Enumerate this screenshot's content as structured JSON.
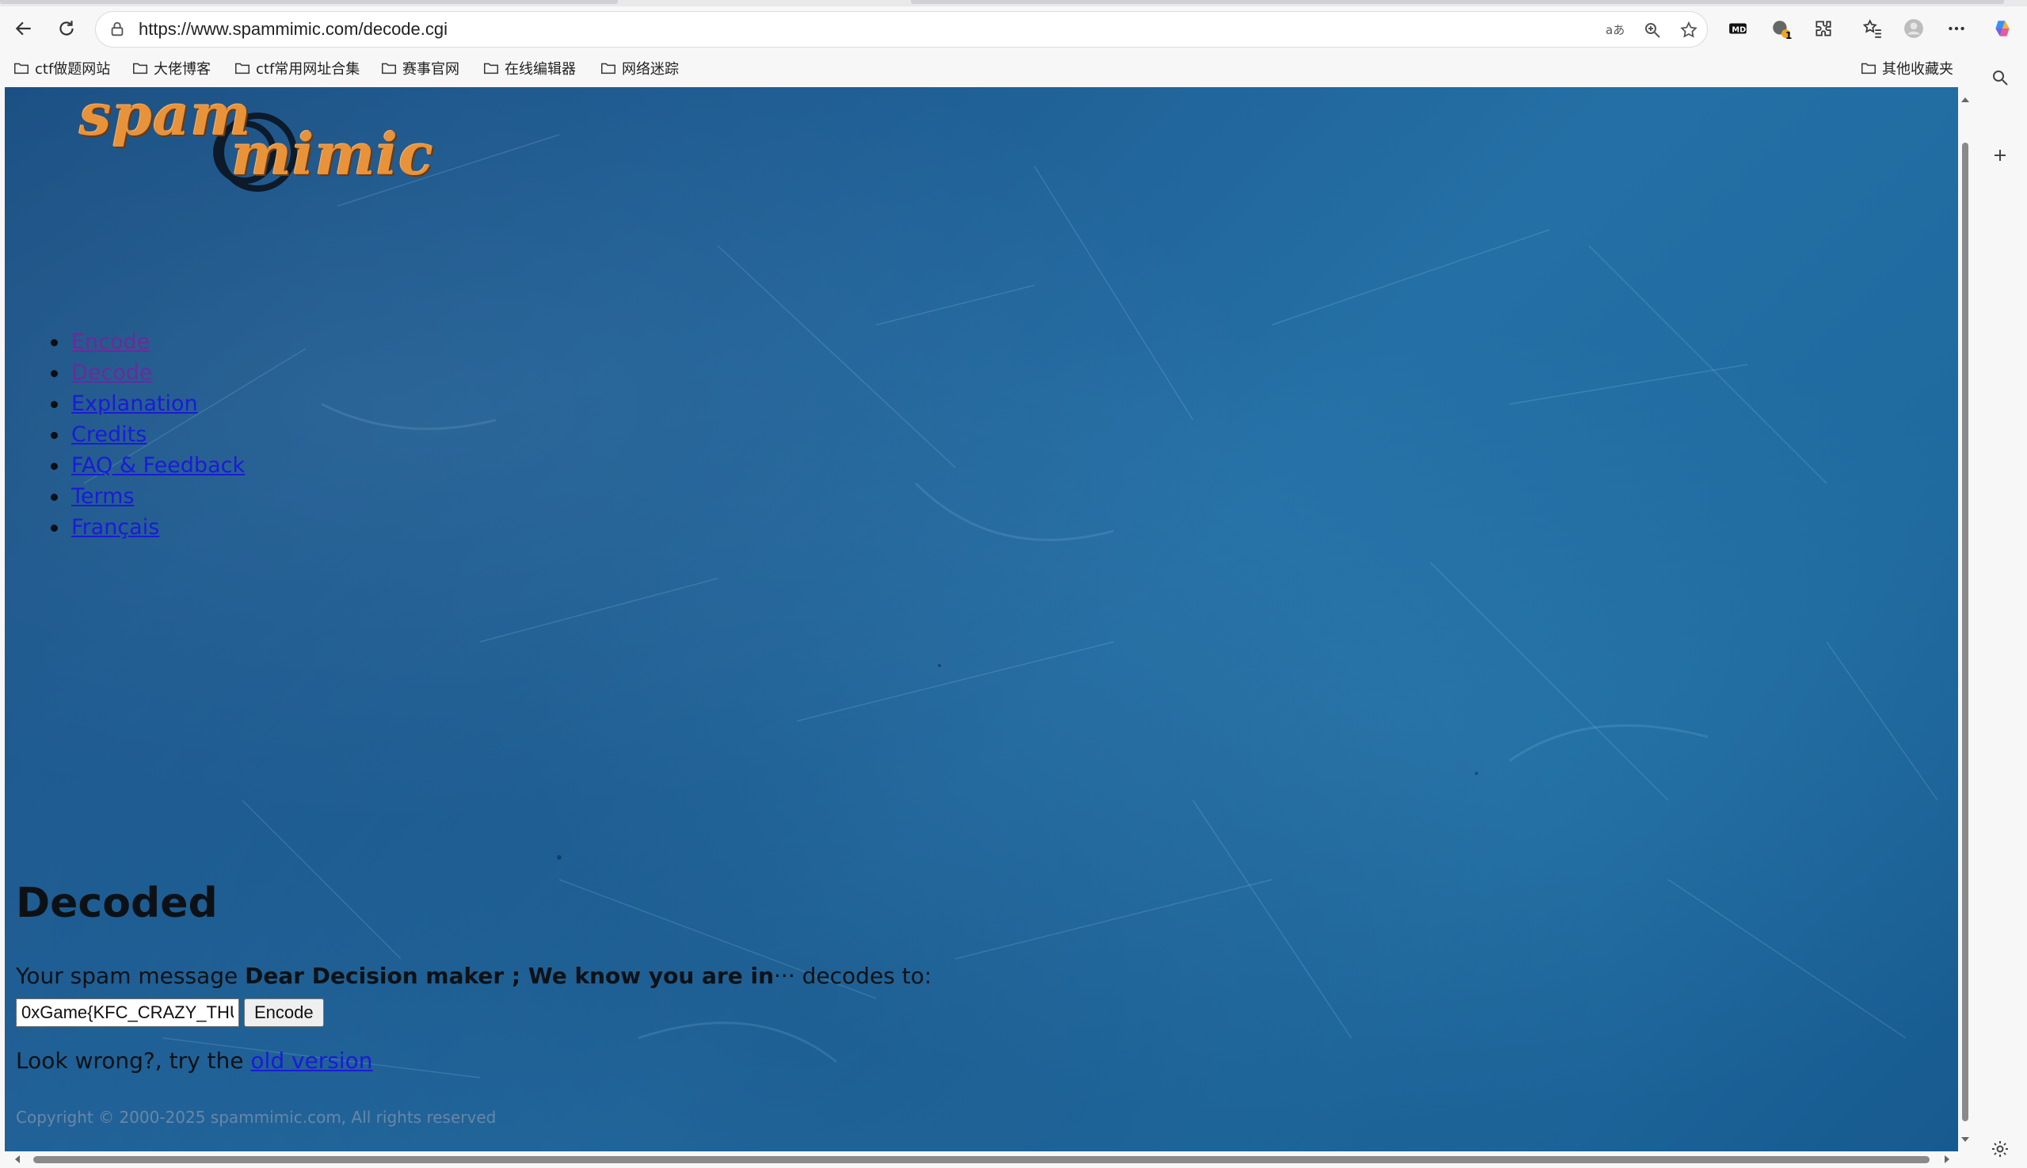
{
  "browser": {
    "url": "https://www.spammimic.com/decode.cgi",
    "bookmarks": [
      {
        "label": "ctf做题网站"
      },
      {
        "label": "大佬博客"
      },
      {
        "label": "ctf常用网址合集"
      },
      {
        "label": "赛事官网"
      },
      {
        "label": "在线编辑器"
      },
      {
        "label": "网络迷踪"
      }
    ],
    "other_bookmarks": "其他收藏夹",
    "extension_badge": "1",
    "colors": {
      "accent": "#1a1bd8",
      "chrome": "#f7f7f7"
    }
  },
  "page": {
    "logo": {
      "line1": "spam",
      "line2": "mimic"
    },
    "nav": [
      {
        "label": "Encode",
        "visited": true
      },
      {
        "label": "Decode",
        "visited": true
      },
      {
        "label": "Explanation",
        "visited": false
      },
      {
        "label": "Credits",
        "visited": false
      },
      {
        "label": "FAQ & Feedback",
        "visited": false
      },
      {
        "label": "Terms",
        "visited": false
      },
      {
        "label": "Français",
        "visited": false
      }
    ],
    "heading": "Decoded",
    "message_prefix": "Your spam message ",
    "message_bold": "Dear Decision maker ; We know you are in",
    "message_ellipsis": "··· ",
    "message_suffix": "decodes to:",
    "result_value": "0xGame{KFC_CRAZY_THU",
    "encode_button": "Encode",
    "look_wrong_prefix": "Look wrong?, try the ",
    "old_version_link": "old version",
    "copyright": "Copyright © 2000-2025 spammimic.com, All rights reserved"
  }
}
